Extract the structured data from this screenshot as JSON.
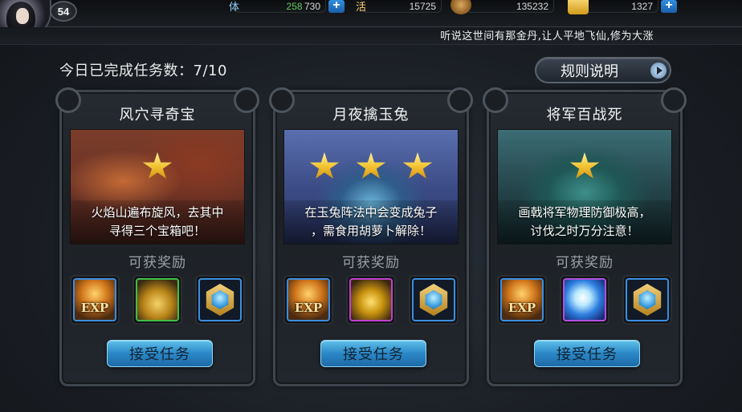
{
  "player": {
    "level": "54"
  },
  "resources": {
    "stamina": {
      "label": "体",
      "current": "258",
      "max": "730",
      "color": "#5ec95e"
    },
    "vitality": {
      "label": "活",
      "value": "15725"
    },
    "silver": {
      "value": "135232"
    },
    "gold": {
      "value": "1327"
    },
    "plus_icon": "plus-icon"
  },
  "ticker": {
    "text": "听说这世间有那金丹,让人平地飞仙,修为大涨"
  },
  "header": {
    "progress": "今日已完成任务数：7/10",
    "rules_label": "规则说明"
  },
  "reward_label": "可获奖励",
  "accept_label": "接受任务",
  "tasks": [
    {
      "title": "风穴寻奇宝",
      "stars": 1,
      "desc_line1": "火焰山遍布旋风，去其中",
      "desc_line2": "寻得三个宝箱吧！",
      "rewards": [
        "exp",
        "gold-coins",
        "blue-gem"
      ],
      "exp_label": "EXP"
    },
    {
      "title": "月夜擒玉兔",
      "stars": 3,
      "desc_line1": "在玉兔阵法中会变成兔子",
      "desc_line2": "，需食用胡萝卜解除！",
      "rewards": [
        "exp",
        "gold-bag",
        "blue-gem"
      ],
      "exp_label": "EXP"
    },
    {
      "title": "将军百战死",
      "stars": 1,
      "desc_line1": "画戟将军物理防御极高，",
      "desc_line2": "讨伐之时万分注意！",
      "rewards": [
        "exp",
        "spirit-orb",
        "blue-gem"
      ],
      "exp_label": "EXP"
    }
  ]
}
